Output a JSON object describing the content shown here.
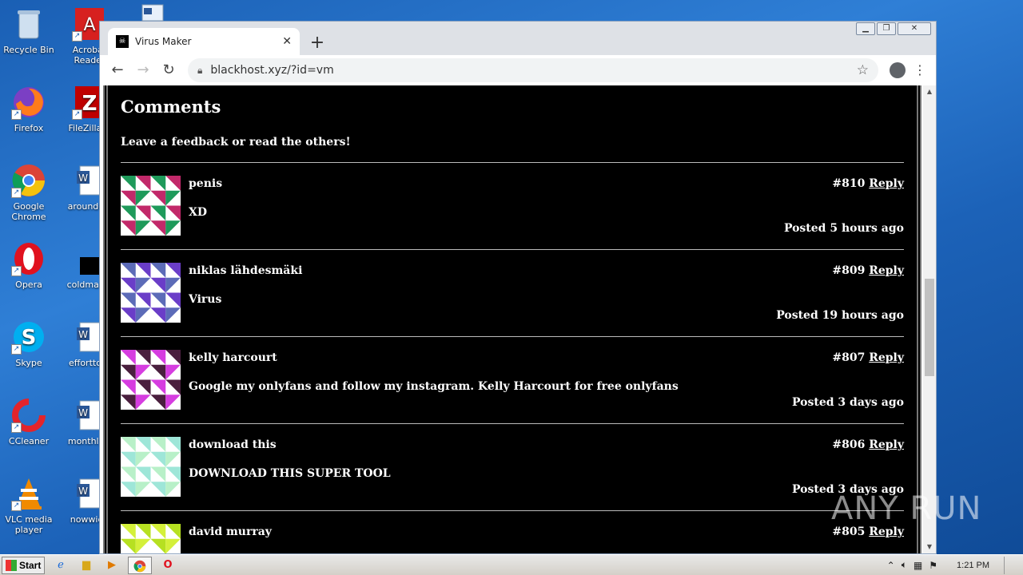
{
  "desktop": {
    "icons": [
      {
        "label": "Recycle Bin"
      },
      {
        "label": "Acrobat Reader"
      },
      {
        "label": "Firefox"
      },
      {
        "label": "FileZilla C"
      },
      {
        "label": "Google Chrome"
      },
      {
        "label": "aroundchi"
      },
      {
        "label": "Opera"
      },
      {
        "label": "coldmaxin"
      },
      {
        "label": "Skype"
      },
      {
        "label": "efforttota"
      },
      {
        "label": "CCleaner"
      },
      {
        "label": "monthlyw"
      },
      {
        "label": "VLC media player"
      },
      {
        "label": "nowwide"
      }
    ]
  },
  "browser": {
    "tab_title": "Virus Maker",
    "url": "blackhost.xyz/?id=vm",
    "favicon_glyph": "☠"
  },
  "page": {
    "heading": "Comments",
    "subtitle": "Leave a feedback or read the others!",
    "reply_label": "Reply",
    "comments": [
      {
        "author": "penis",
        "id": "#810",
        "body": "XD",
        "posted": "Posted 5 hours ago",
        "colors": [
          "#c2296a",
          "#1e9a5a",
          "#ffffff"
        ]
      },
      {
        "author": "niklas lähdesmäki",
        "id": "#809",
        "body": "Virus",
        "posted": "Posted 19 hours ago",
        "colors": [
          "#6a3dc8",
          "#5c6bb8",
          "#ffffff"
        ]
      },
      {
        "author": "kelly harcourt",
        "id": "#807",
        "body": "Google my onlyfans and follow my instagram. Kelly Harcourt for free onlyfans",
        "posted": "Posted 3 days ago",
        "colors": [
          "#4a1f3e",
          "#d63de0",
          "#ffffff"
        ]
      },
      {
        "author": "download this",
        "id": "#806",
        "body": "DOWNLOAD THIS SUPER TOOL",
        "posted": "Posted 3 days ago",
        "colors": [
          "#9ee6d8",
          "#b8f0c8",
          "#ffffff"
        ]
      },
      {
        "author": "david murray",
        "id": "#805",
        "body": "",
        "posted": "",
        "colors": [
          "#b6e021",
          "#d4f03a",
          "#ffffff"
        ]
      }
    ]
  },
  "watermark": "ANY RUN",
  "taskbar": {
    "start_label": "Start",
    "clock": "1:21 PM"
  }
}
